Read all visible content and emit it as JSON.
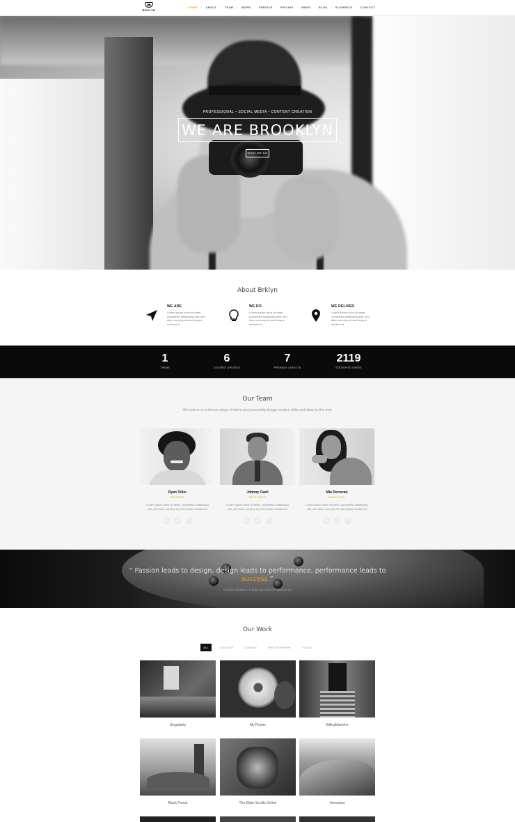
{
  "nav": {
    "logo_text": "BRKLYN",
    "items": [
      "HOME",
      "ABOUT",
      "TEAM",
      "WORK",
      "SERVICE",
      "PRICING",
      "NEWS",
      "BLOG",
      "ELEMENTS",
      "CONTACT"
    ],
    "active": "HOME"
  },
  "hero": {
    "kicker": "PROFESSIONAL • SOCIAL MEDIA • CONTENT CREATION",
    "title": "WE ARE BROOKLYN",
    "button": "WHAT WE DO"
  },
  "about": {
    "title": "About Brklyn",
    "features": [
      {
        "icon": "navigation-arrow-icon",
        "heading": "WE ARE",
        "text": "Lorem ipsum dolor sit amet, consetetur sadipscing elitr, sed diam nonumy eirmod tempor invidunt ut"
      },
      {
        "icon": "lightbulb-icon",
        "heading": "WE DO",
        "text": "Lorem ipsum dolor sit amet, consetetur sadipscing elitr, sed diam nonumy eirmod tempor invidunt ut"
      },
      {
        "icon": "map-pin-icon",
        "heading": "WE DELIVER",
        "text": "Lorem ipsum dolor sit amet, consetetur sadipscing elitr, sed diam nonumy eirmod tempor invidunt ut"
      }
    ]
  },
  "stats": [
    {
      "value": "1",
      "label": "THEME"
    },
    {
      "value": "6",
      "label": "CONTENT UPDATES"
    },
    {
      "value": "7",
      "label": "PREMADE LAYOUTS"
    },
    {
      "value": "2119",
      "label": "STATISFIED USERS"
    }
  ],
  "team": {
    "title": "Our Team",
    "subtitle": "We believe in a diverse range of talent and personality brings creative skills and ideas to the web.",
    "members": [
      {
        "name": "Ryan Teller",
        "role": "DESIGNER",
        "bio": "Lorem ipsum dolor sit amet, consetetur sadipscing elitr, sed diam nonumy eirmod tempor invidunt ut"
      },
      {
        "name": "Johnny Cash",
        "role": "DEVELOPER",
        "bio": "Lorem ipsum dolor sit amet, consetetur sadipscing elitr, sed diam nonumy eirmod tempor invidunt ut"
      },
      {
        "name": "Mia Donovan",
        "role": "MARKETING",
        "bio": "Lorem ipsum dolor sit amet, consetetur sadipscing elitr, sed diam nonumy eirmod tempor invidunt ut"
      }
    ],
    "social_glyphs": [
      "f",
      "t",
      "g"
    ]
  },
  "quote": {
    "line1": "Passion leads to design, design leads to performance, performance leads to",
    "line2_accent": "success",
    "author": "UNITED THEMES • THEME AUTHOR OF BROOKLYN"
  },
  "work": {
    "title": "Our Work",
    "filters": [
      "ALL",
      "GALLERY",
      "GAMING",
      "PHOTOGRAPHY",
      "VIDEO"
    ],
    "active_filter": "ALL",
    "items": [
      "Singularity",
      "My Flower",
      "KillingMachine",
      "Black Forest",
      "The Elder Scrolls Online",
      "Armonica"
    ]
  },
  "colors": {
    "accent": "#f0a500",
    "dark": "#0a0a0a",
    "light_bg": "#f5f5f5"
  }
}
